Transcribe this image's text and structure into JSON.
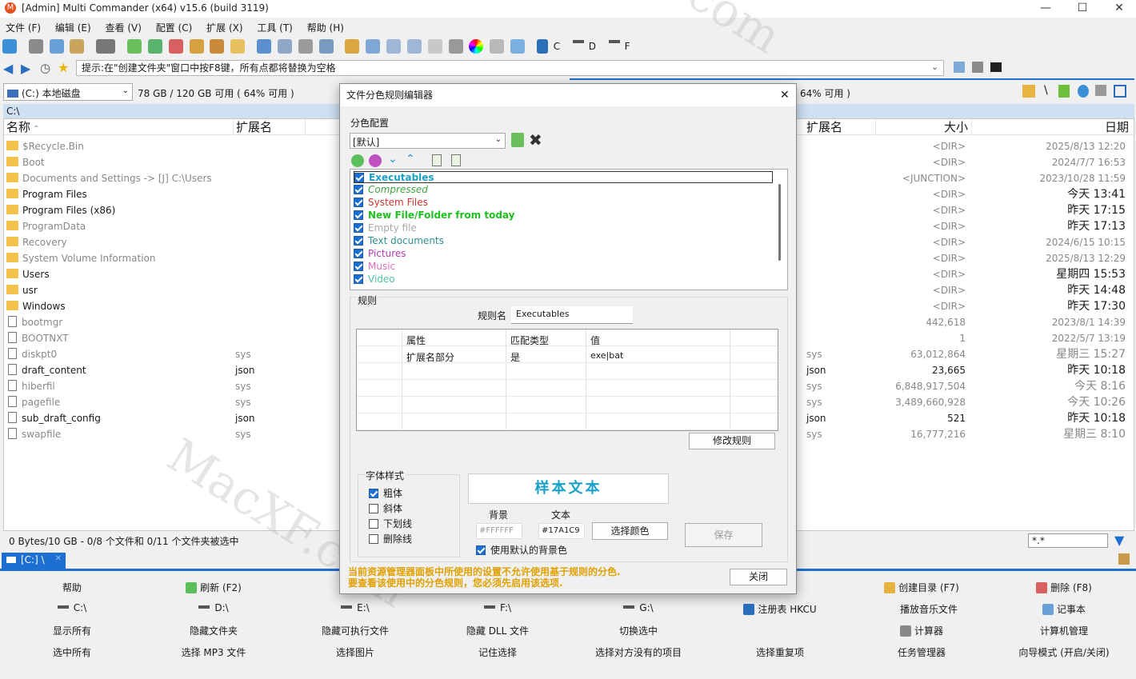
{
  "window": {
    "title": "[Admin] Multi Commander (x64)  v15.6 (build 3119)",
    "min": "—",
    "max": "☐",
    "close": "✕"
  },
  "menu": [
    "文件 (F)",
    "编辑 (E)",
    "查看 (V)",
    "配置 (C)",
    "扩展 (X)",
    "工具 (T)",
    "帮助 (H)"
  ],
  "toolbar": {
    "drives": [
      "C",
      "D",
      "F"
    ]
  },
  "address": {
    "hint": "提示:在\"创建文件夹\"窗口中按F8键，所有点都将替换为空格"
  },
  "left_panel": {
    "drive": "(C:) 本地磁盘",
    "free": "78 GB / 120 GB 可用 ( 64% 可用 )",
    "path": "C:\\",
    "col_name": "名称",
    "col_ext": "扩展名",
    "files": [
      {
        "name": "$Recycle.Bin",
        "ext": "",
        "type": "folder",
        "gray": true
      },
      {
        "name": "Boot",
        "ext": "",
        "type": "folder",
        "gray": true
      },
      {
        "name": "Documents and Settings ->  [J] C:\\Users",
        "ext": "",
        "type": "folder",
        "gray": true
      },
      {
        "name": "Program Files",
        "ext": "",
        "type": "folder",
        "gray": false
      },
      {
        "name": "Program Files (x86)",
        "ext": "",
        "type": "folder",
        "gray": false
      },
      {
        "name": "ProgramData",
        "ext": "",
        "type": "folder",
        "gray": true
      },
      {
        "name": "Recovery",
        "ext": "",
        "type": "folder",
        "gray": true
      },
      {
        "name": "System Volume Information",
        "ext": "",
        "type": "folder",
        "gray": true
      },
      {
        "name": "Users",
        "ext": "",
        "type": "folder",
        "gray": false
      },
      {
        "name": "usr",
        "ext": "",
        "type": "folder",
        "gray": false
      },
      {
        "name": "Windows",
        "ext": "",
        "type": "folder",
        "gray": false
      },
      {
        "name": "bootmgr",
        "ext": "",
        "type": "file",
        "gray": true
      },
      {
        "name": "BOOTNXT",
        "ext": "",
        "type": "file",
        "gray": true
      },
      {
        "name": "diskpt0",
        "ext": "sys",
        "type": "file",
        "gray": true
      },
      {
        "name": "draft_content",
        "ext": "json",
        "type": "file",
        "gray": false
      },
      {
        "name": "hiberfil",
        "ext": "sys",
        "type": "file",
        "gray": true
      },
      {
        "name": "pagefile",
        "ext": "sys",
        "type": "file",
        "gray": true
      },
      {
        "name": "sub_draft_config",
        "ext": "json",
        "type": "file",
        "gray": false
      },
      {
        "name": "swapfile",
        "ext": "sys",
        "type": "file",
        "gray": true
      }
    ],
    "status": "0 Bytes/10 GB - 0/8 个文件和 0/11 个文件夹被选中",
    "tab": "[C:] \\"
  },
  "right_panel": {
    "free": "64% 可用 )",
    "col_ext": "扩展名",
    "col_size": "大小",
    "col_date": "日期",
    "filter": "*.*",
    "rows": [
      {
        "ext": "",
        "size": "<DIR>",
        "date": "2025/8/13 12:20",
        "big": false
      },
      {
        "ext": "",
        "size": "<DIR>",
        "date": "2024/7/7 16:53",
        "big": false
      },
      {
        "ext": "",
        "size": "<JUNCTION>",
        "date": "2023/10/28 11:59",
        "big": false
      },
      {
        "ext": "",
        "size": "<DIR>",
        "date": "今天 13:41",
        "big": true
      },
      {
        "ext": "",
        "size": "<DIR>",
        "date": "昨天 17:15",
        "big": true
      },
      {
        "ext": "",
        "size": "<DIR>",
        "date": "昨天 17:13",
        "big": true
      },
      {
        "ext": "",
        "size": "<DIR>",
        "date": "2024/6/15 10:15",
        "big": false
      },
      {
        "ext": "",
        "size": "<DIR>",
        "date": "2025/8/13 12:29",
        "big": false
      },
      {
        "ext": "",
        "size": "<DIR>",
        "date": "星期四 15:53",
        "big": true
      },
      {
        "ext": "",
        "size": "<DIR>",
        "date": "昨天 14:48",
        "big": true
      },
      {
        "ext": "",
        "size": "<DIR>",
        "date": "昨天 17:30",
        "big": true
      },
      {
        "ext": "",
        "size": "442,618",
        "date": "2023/8/1 14:39",
        "big": false
      },
      {
        "ext": "",
        "size": "1",
        "date": "2022/5/7 13:19",
        "big": false
      },
      {
        "ext": "sys",
        "size": "63,012,864",
        "date": "星期三 15:27",
        "big": true
      },
      {
        "ext": "json",
        "size": "23,665",
        "date": "昨天 10:18",
        "big": true
      },
      {
        "ext": "sys",
        "size": "6,848,917,504",
        "date": "今天 8:16",
        "big": true
      },
      {
        "ext": "sys",
        "size": "3,489,660,928",
        "date": "今天 10:26",
        "big": true
      },
      {
        "ext": "json",
        "size": "521",
        "date": "昨天 10:18",
        "big": true
      },
      {
        "ext": "sys",
        "size": "16,777,216",
        "date": "星期三 8:10",
        "big": true
      }
    ]
  },
  "dialog": {
    "title": "文件分色规则编辑器",
    "close": "✕",
    "config_label": "分色配置",
    "config_value": "[默认]",
    "rules": [
      {
        "name": "Executables",
        "color": "#17A1C9",
        "bold": true,
        "italic": false,
        "selected": true
      },
      {
        "name": "Compressed",
        "color": "#3fa33f",
        "bold": false,
        "italic": true,
        "selected": false
      },
      {
        "name": "System Files",
        "color": "#d0342c",
        "bold": false,
        "italic": false,
        "selected": false
      },
      {
        "name": "New File/Folder from today",
        "color": "#1fbf1f",
        "bold": true,
        "italic": false,
        "selected": false
      },
      {
        "name": "Empty file",
        "color": "#a8a8a8",
        "bold": false,
        "italic": false,
        "selected": false
      },
      {
        "name": "Text documents",
        "color": "#2f8f8f",
        "bold": false,
        "italic": false,
        "selected": false
      },
      {
        "name": "Pictures",
        "color": "#b23ab2",
        "bold": false,
        "italic": false,
        "selected": false
      },
      {
        "name": "Music",
        "color": "#d86fb8",
        "bold": false,
        "italic": false,
        "selected": false
      },
      {
        "name": "Video",
        "color": "#4fbfa0",
        "bold": false,
        "italic": false,
        "selected": false
      }
    ],
    "rule_group": "规则",
    "rule_name_label": "规则名",
    "rule_name_value": "Executables",
    "table_headers": [
      "属性",
      "匹配类型",
      "值"
    ],
    "table_rows": [
      [
        "扩展名部分",
        "是",
        "exe|bat"
      ]
    ],
    "modify_button": "修改规则",
    "font_style_group": "字体样式",
    "styles": [
      {
        "label": "粗体",
        "checked": true
      },
      {
        "label": "斜体",
        "checked": false
      },
      {
        "label": "下划线",
        "checked": false
      },
      {
        "label": "删除线",
        "checked": false
      }
    ],
    "sample_text": "样本文本",
    "bg_label": "背景",
    "text_label": "文本",
    "bg_value": "#FFFFFF",
    "text_value": "#17A1C9",
    "pick_color": "选择颜色",
    "save": "保存",
    "use_default_bg": "使用默认的背景色",
    "warning_1": "当前资源管理器面板中所使用的设置不允许使用基于规则的分色.",
    "warning_2": "要查看该使用中的分色规则，您必须先启用该选项.",
    "close_button": "关闭"
  },
  "fkeys": {
    "row1": [
      "帮助",
      "刷新 (F2)",
      "",
      "",
      "",
      "",
      "创建目录 (F7)",
      "删除 (F8)"
    ],
    "row2": [
      "C:\\",
      "D:\\",
      "E:\\",
      "F:\\",
      "G:\\",
      "注册表 HKCU",
      "播放音乐文件",
      "记事本"
    ],
    "row3": [
      "显示所有",
      "隐藏文件夹",
      "隐藏可执行文件",
      "隐藏 DLL 文件",
      "切换选中",
      "",
      "计算器",
      "计算机管理"
    ],
    "row4": [
      "选中所有",
      "选择 MP3 文件",
      "选择图片",
      "记住选择",
      "选择对方没有的项目",
      "选择重复项",
      "任务管理器",
      "向导模式 (开启/关闭)"
    ]
  },
  "colors": {
    "accent": "#1d6fd1",
    "panel_header": "#cfe0f3",
    "warning": "#e0a000"
  }
}
